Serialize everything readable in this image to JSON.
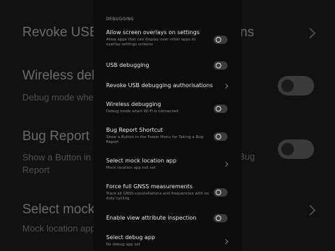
{
  "background": {
    "items": [
      {
        "title": "Revoke USB",
        "extra": "ns"
      },
      {
        "title": "Wireless deb",
        "sub": "Debug mode whe"
      },
      {
        "title": "Bug Report",
        "sub1": "Show a Button in",
        "sub2": "Report",
        "extra": "Bug"
      },
      {
        "title": "Select mock",
        "sub": "Mock location app"
      }
    ]
  },
  "panel": {
    "section_header": "DEBUGGING",
    "rows": [
      {
        "title": "Allow screen overlays on settings",
        "sub": "Allow apps that can display over other apps to overlay settings screens",
        "control": "toggle",
        "on": false
      },
      {
        "title": "USB debugging",
        "control": "toggle",
        "on": false
      },
      {
        "title": "Revoke USB debugging authorisations",
        "control": "chevron"
      },
      {
        "title": "Wireless debugging",
        "sub": "Debug mode when Wi-Fi is connected",
        "control": "toggle",
        "on": false
      },
      {
        "title": "Bug Report Shortcut",
        "sub": "Show a Button in the Power Menu for Taking a Bug Report",
        "control": "toggle",
        "on": false
      },
      {
        "title": "Select mock location app",
        "sub": "Mock location app not set",
        "control": "chevron"
      },
      {
        "title": "Force full GNSS measurements",
        "sub": "Track all GNSS constellations and frequencies with no duty cycling",
        "control": "toggle",
        "on": false
      },
      {
        "title": "Enable view attribute inspection",
        "control": "toggle",
        "on": false
      },
      {
        "title": "Select debug app",
        "sub": "No debug app set",
        "control": "chevron"
      }
    ]
  }
}
